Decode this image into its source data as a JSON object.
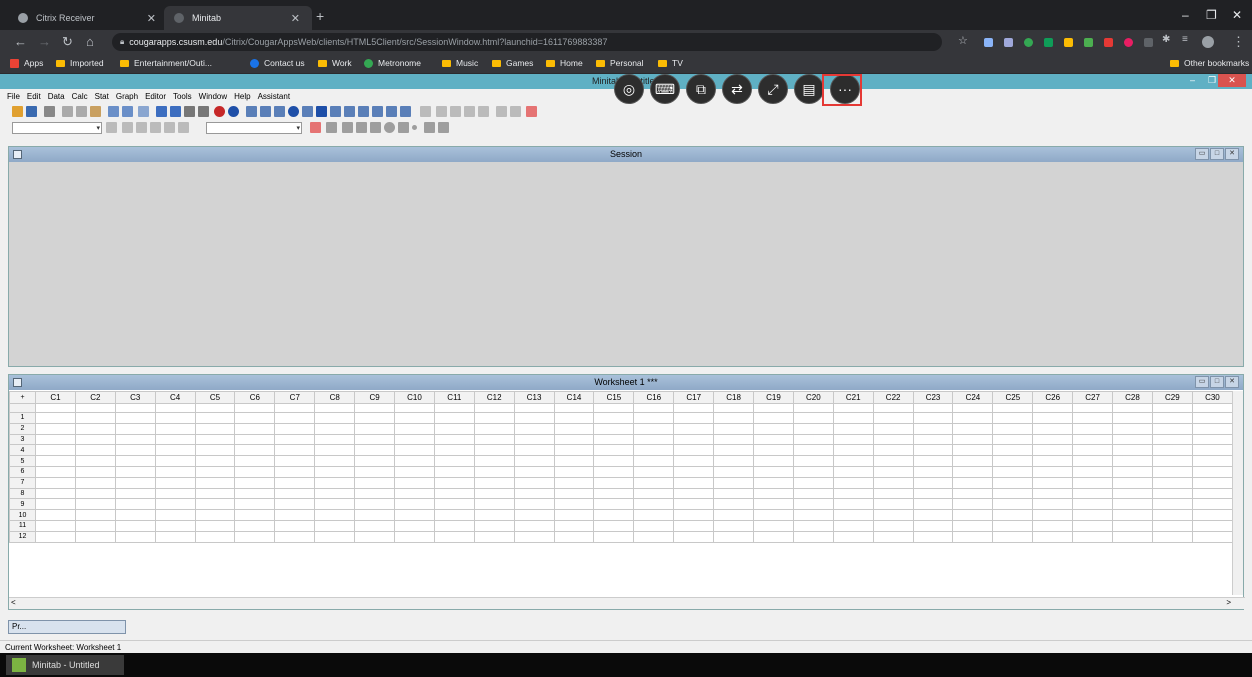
{
  "browser": {
    "tabs": [
      {
        "label": "Citrix Receiver",
        "icon": "citrix-icon",
        "active": false
      },
      {
        "label": "Minitab",
        "icon": "globe-icon",
        "active": true
      }
    ],
    "new_tab": "+",
    "window_controls": {
      "minimize": "–",
      "maximize": "❐",
      "close": "✕"
    },
    "address": {
      "host": "cougarapps.csusm.edu",
      "path": "/Citrix/CougarAppsWeb/clients/HTML5Client/src/SessionWindow.html?launchid=1611769883387"
    },
    "bookmarks": [
      "Apps",
      "Imported",
      "Entertainment/Outi...",
      "Contact us",
      "Work",
      "Metronome",
      "Music",
      "Games",
      "Home",
      "Personal",
      "TV"
    ],
    "other_bookmarks": "Other bookmarks"
  },
  "minitab": {
    "title": "Minitab - Untitled",
    "menu": [
      "File",
      "Edit",
      "Data",
      "Calc",
      "Stat",
      "Graph",
      "Editor",
      "Tools",
      "Window",
      "Help",
      "Assistant"
    ],
    "session": {
      "title": "Session"
    },
    "worksheet": {
      "title": "Worksheet 1 ***",
      "corner": "+",
      "columns": [
        "C1",
        "C2",
        "C3",
        "C4",
        "C5",
        "C6",
        "C7",
        "C8",
        "C9",
        "C10",
        "C11",
        "C12",
        "C13",
        "C14",
        "C15",
        "C16",
        "C17",
        "C18",
        "C19",
        "C20",
        "C21",
        "C22",
        "C23",
        "C24",
        "C25",
        "C26",
        "C27",
        "C28",
        "C29",
        "C30"
      ],
      "rows": [
        "1",
        "2",
        "3",
        "4",
        "5",
        "6",
        "7",
        "8",
        "9",
        "10",
        "11",
        "12"
      ]
    },
    "minimized_project": "Pr...",
    "status": "Current Worksheet: Worksheet 1"
  },
  "citrix_toolbar": {
    "buttons": [
      "citrix-logo-icon",
      "keyboard-icon",
      "multi-monitor-icon",
      "switch-display-icon",
      "fullscreen-icon",
      "clipboard-icon",
      "more-icon"
    ]
  },
  "taskbar": {
    "item": "Minitab - Untitled"
  }
}
